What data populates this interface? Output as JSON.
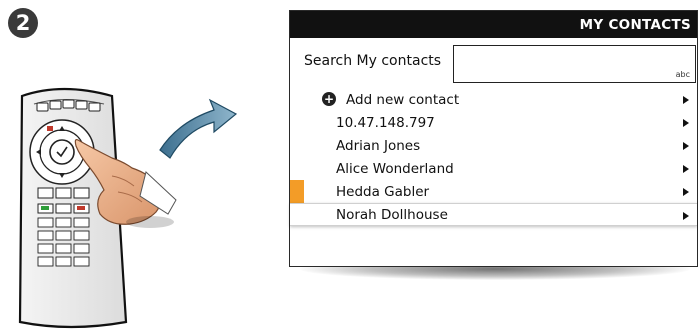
{
  "step": {
    "number": "2"
  },
  "panel": {
    "title": "MY CONTACTS",
    "search": {
      "label": "Search My contacts",
      "value": "",
      "mode": "abc"
    },
    "add_contact_label": "Add new contact",
    "contacts": [
      {
        "name": "10.47.148.797"
      },
      {
        "name": "Adrian Jones"
      },
      {
        "name": "Alice Wonderland"
      },
      {
        "name": "Hedda Gabler",
        "selected": true
      },
      {
        "name": "Norah Dollhouse",
        "focused": true
      }
    ]
  },
  "colors": {
    "header_bg": "#111111",
    "selection_marker": "#f39c27",
    "arrow": "#5b87a3"
  }
}
